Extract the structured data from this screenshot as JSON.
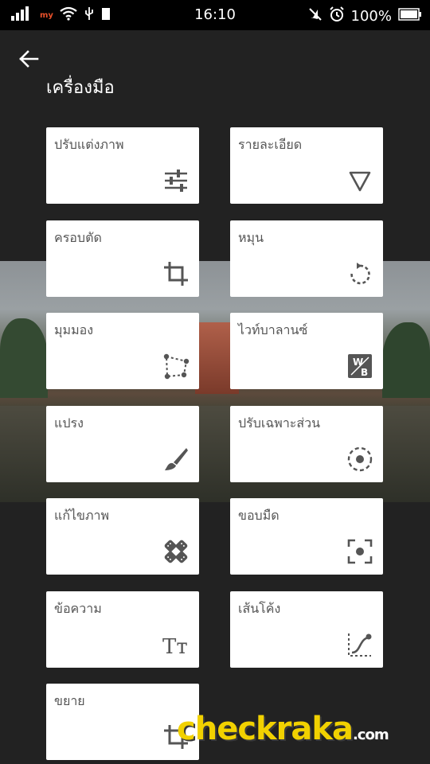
{
  "status_bar": {
    "carrier": "my",
    "time": "16:10",
    "battery": "100%"
  },
  "header": {
    "title": "เครื่องมือ"
  },
  "tools": [
    {
      "label": "ปรับแต่งภาพ",
      "icon": "sliders-icon"
    },
    {
      "label": "รายละเอียด",
      "icon": "triangle-down-icon"
    },
    {
      "label": "ครอบตัด",
      "icon": "crop-icon"
    },
    {
      "label": "หมุน",
      "icon": "rotate-icon"
    },
    {
      "label": "มุมมอง",
      "icon": "perspective-icon"
    },
    {
      "label": "ไวท์บาลานซ์",
      "icon": "white-balance-icon"
    },
    {
      "label": "แปรง",
      "icon": "brush-icon"
    },
    {
      "label": "ปรับเฉพาะส่วน",
      "icon": "selective-icon"
    },
    {
      "label": "แก้ไขภาพ",
      "icon": "healing-icon"
    },
    {
      "label": "ขอบมืด",
      "icon": "vignette-icon"
    },
    {
      "label": "ข้อความ",
      "icon": "text-icon"
    },
    {
      "label": "เส้นโค้ง",
      "icon": "curves-icon"
    },
    {
      "label": "ขยาย",
      "icon": "expand-icon"
    }
  ],
  "white_balance_icon_text": {
    "w": "W",
    "b": "B"
  },
  "text_icon_text": "Tт",
  "watermark": {
    "main": "checkraka",
    "suffix": ".com"
  },
  "colors": {
    "background": "#222222",
    "card": "#ffffff",
    "icon": "#555555",
    "watermark": "#f1d100"
  }
}
